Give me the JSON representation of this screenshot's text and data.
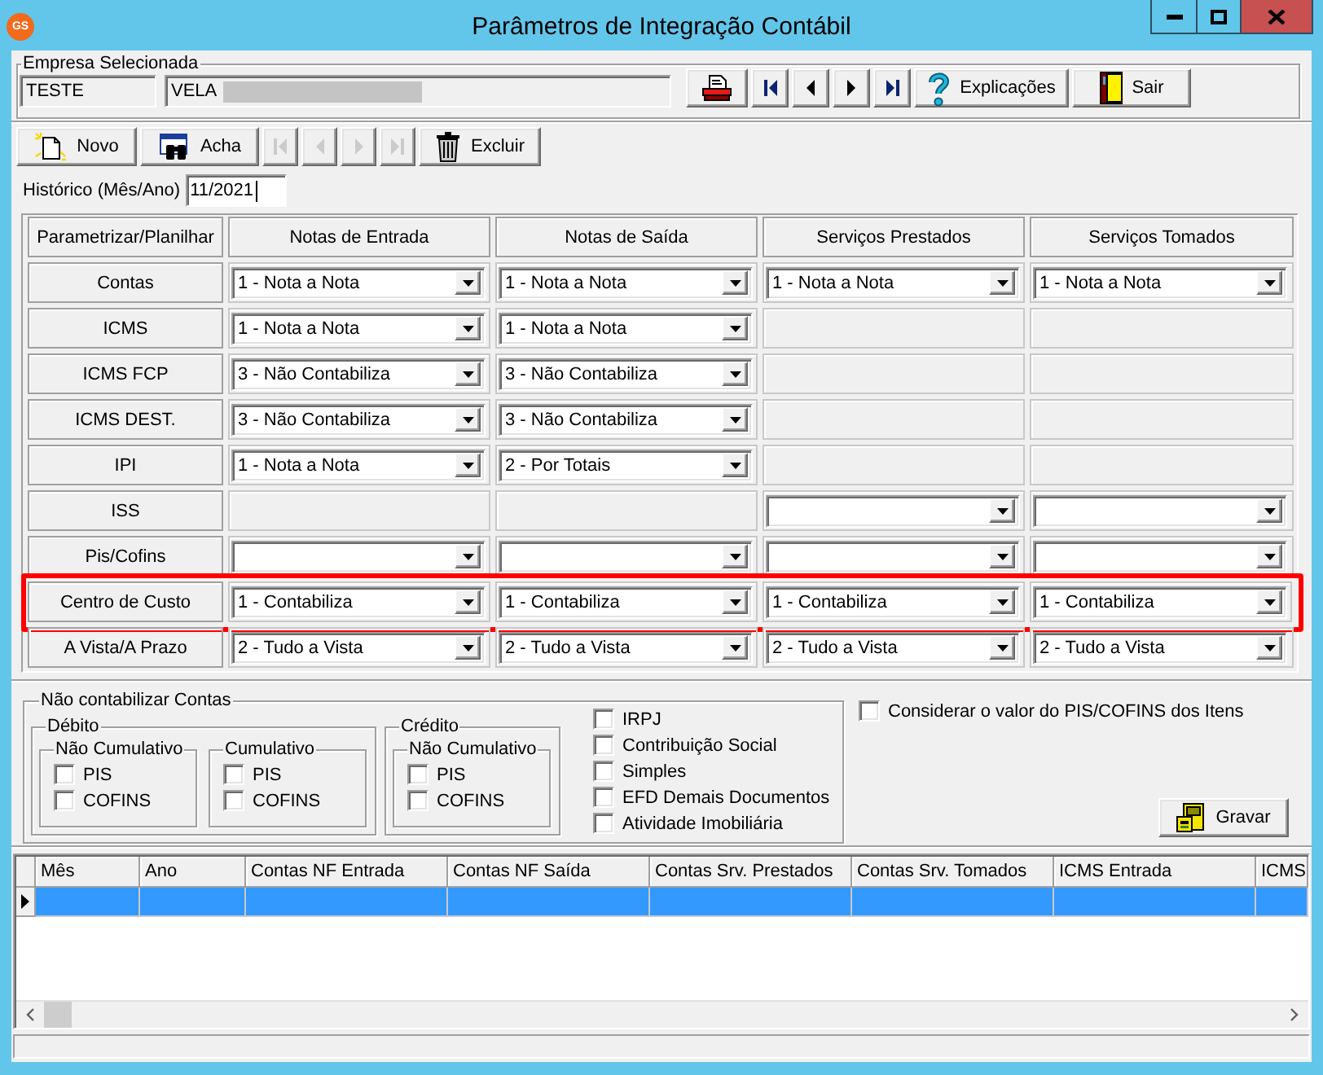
{
  "window": {
    "title": "Parâmetros de Integração Contábil",
    "logo_text": "GS"
  },
  "company": {
    "label": "Empresa Selecionada",
    "code": "TESTE",
    "name": "VELA",
    "redacted": true
  },
  "top_toolbar": [
    {
      "kind": "print",
      "disabled": false
    },
    {
      "kind": "first",
      "disabled": false
    },
    {
      "kind": "prev",
      "disabled": false
    },
    {
      "kind": "next",
      "disabled": false
    },
    {
      "kind": "last",
      "disabled": false
    },
    {
      "kind": "help",
      "label": "Explicações",
      "disabled": false
    },
    {
      "kind": "exit",
      "label": "Sair",
      "disabled": false
    }
  ],
  "record_toolbar": [
    {
      "kind": "new",
      "label": "Novo",
      "disabled": false
    },
    {
      "kind": "find",
      "label": "Acha",
      "disabled": false
    },
    {
      "kind": "first",
      "disabled": true
    },
    {
      "kind": "prev",
      "disabled": true
    },
    {
      "kind": "next",
      "disabled": true
    },
    {
      "kind": "last",
      "disabled": true
    },
    {
      "kind": "delete",
      "label": "Excluir",
      "disabled": false
    }
  ],
  "history_field": {
    "label": "Histórico (Mês/Ano)",
    "value": "11/2021",
    "focused": true
  },
  "params_grid": {
    "corner": "Parametrizar/Planilhar",
    "columns": [
      "Notas de Entrada",
      "Notas de Saída",
      "Serviços Prestados",
      "Serviços Tomados"
    ],
    "rows": [
      {
        "label": "Contas",
        "highlighted": false,
        "cells": [
          {
            "kind": "combo",
            "value": "1 - Nota a Nota"
          },
          {
            "kind": "combo",
            "value": "1 - Nota a Nota"
          },
          {
            "kind": "combo",
            "value": "1 - Nota a Nota"
          },
          {
            "kind": "combo",
            "value": "1 - Nota a Nota"
          }
        ]
      },
      {
        "label": "ICMS",
        "highlighted": false,
        "cells": [
          {
            "kind": "combo",
            "value": "1 - Nota a Nota"
          },
          {
            "kind": "combo",
            "value": "1 - Nota a Nota"
          },
          {
            "kind": "empty"
          },
          {
            "kind": "empty"
          }
        ]
      },
      {
        "label": "ICMS FCP",
        "highlighted": false,
        "cells": [
          {
            "kind": "combo",
            "value": "3 - Não Contabiliza"
          },
          {
            "kind": "combo",
            "value": "3 - Não Contabiliza"
          },
          {
            "kind": "empty"
          },
          {
            "kind": "empty"
          }
        ]
      },
      {
        "label": "ICMS DEST.",
        "highlighted": false,
        "cells": [
          {
            "kind": "combo",
            "value": "3 - Não Contabiliza"
          },
          {
            "kind": "combo",
            "value": "3 - Não Contabiliza"
          },
          {
            "kind": "empty"
          },
          {
            "kind": "empty"
          }
        ]
      },
      {
        "label": "IPI",
        "highlighted": false,
        "cells": [
          {
            "kind": "combo",
            "value": "1 - Nota a Nota"
          },
          {
            "kind": "combo",
            "value": "2 - Por Totais"
          },
          {
            "kind": "empty"
          },
          {
            "kind": "empty"
          }
        ]
      },
      {
        "label": "ISS",
        "highlighted": false,
        "cells": [
          {
            "kind": "empty"
          },
          {
            "kind": "empty"
          },
          {
            "kind": "combo"
          },
          {
            "kind": "combo"
          }
        ]
      },
      {
        "label": "Pis/Cofins",
        "highlighted": false,
        "cells": [
          {
            "kind": "combo"
          },
          {
            "kind": "combo"
          },
          {
            "kind": "combo"
          },
          {
            "kind": "combo"
          }
        ]
      },
      {
        "label": "Centro de Custo",
        "highlighted": true,
        "cells": [
          {
            "kind": "combo",
            "value": "1 - Contabiliza"
          },
          {
            "kind": "combo",
            "value": "1 - Contabiliza"
          },
          {
            "kind": "combo",
            "value": "1 - Contabiliza"
          },
          {
            "kind": "combo",
            "value": "1 - Contabiliza"
          }
        ]
      },
      {
        "label": "A Vista/A Prazo",
        "highlighted": false,
        "cells": [
          {
            "kind": "combo",
            "value": "2 - Tudo a Vista"
          },
          {
            "kind": "combo",
            "value": "2 - Tudo a Vista"
          },
          {
            "kind": "combo",
            "value": "2 - Tudo a Vista"
          },
          {
            "kind": "combo",
            "value": "2 - Tudo a Vista"
          }
        ]
      }
    ]
  },
  "exclusions": {
    "title": "Não contabilizar Contas",
    "groups": [
      {
        "title": "Débito",
        "subgroups": [
          {
            "title": "Não Cumulativo",
            "options": [
              {
                "label": "PIS",
                "checked": false
              },
              {
                "label": "COFINS",
                "checked": false
              }
            ]
          },
          {
            "title": "Cumulativo",
            "options": [
              {
                "label": "PIS",
                "checked": false
              },
              {
                "label": "COFINS",
                "checked": false
              }
            ]
          }
        ]
      },
      {
        "title": "Crédito",
        "subgroups": [
          {
            "title": "Não Cumulativo",
            "options": [
              {
                "label": "PIS",
                "checked": false
              },
              {
                "label": "COFINS",
                "checked": false
              }
            ]
          }
        ]
      }
    ],
    "options": [
      {
        "label": "IRPJ",
        "checked": false
      },
      {
        "label": "Contribuição Social",
        "checked": false
      },
      {
        "label": "Simples",
        "checked": false
      },
      {
        "label": "EFD Demais Documentos",
        "checked": false
      },
      {
        "label": "Atividade Imobiliária",
        "checked": false
      }
    ]
  },
  "pis_cofins_items": {
    "label": "Considerar o valor do PIS/COFINS dos Itens",
    "checked": false
  },
  "save_button": {
    "kind": "save",
    "label": "Gravar",
    "disabled": false
  },
  "history_table": {
    "columns": [
      "Mês",
      "Ano",
      "Contas NF Entrada",
      "Contas NF Saída",
      "Contas Srv. Prestados",
      "Contas Srv. Tomados",
      "ICMS Entrada",
      "ICMS"
    ],
    "rows": [
      {
        "selected": true
      }
    ]
  }
}
